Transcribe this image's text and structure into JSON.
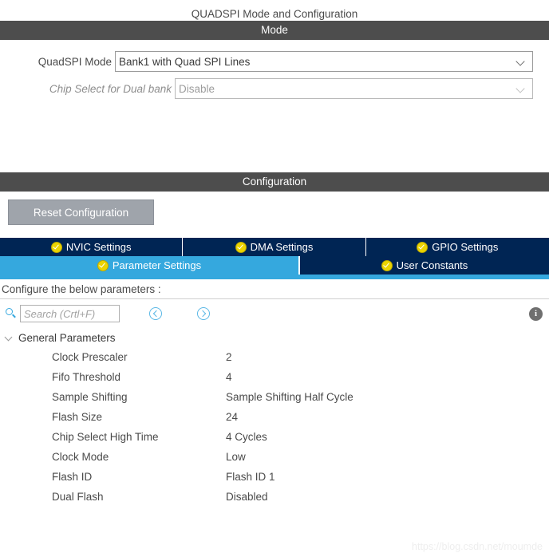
{
  "page_title": "QUADSPI Mode and Configuration",
  "mode_section": {
    "header": "Mode",
    "fields": [
      {
        "label": "QuadSPI Mode",
        "value": "Bank1 with Quad SPI Lines",
        "disabled": false
      },
      {
        "label": "Chip Select for Dual bank",
        "value": "Disable",
        "disabled": true
      }
    ]
  },
  "configuration_section": {
    "header": "Configuration",
    "reset_button": "Reset Configuration",
    "tabs_row1": [
      {
        "label": "NVIC Settings",
        "active": false,
        "icon": "check-circle-icon"
      },
      {
        "label": "DMA Settings",
        "active": false,
        "icon": "check-circle-icon"
      },
      {
        "label": "GPIO Settings",
        "active": false,
        "icon": "check-circle-icon"
      }
    ],
    "tabs_row2": [
      {
        "label": "Parameter Settings",
        "active": true,
        "icon": "check-circle-icon"
      },
      {
        "label": "User Constants",
        "active": false,
        "icon": "check-circle-icon"
      }
    ],
    "configure_text": "Configure the below parameters :",
    "toolbar": {
      "search_icon": "search-icon",
      "search_placeholder": "Search (Crtl+F)",
      "search_value": "",
      "prev_icon": "chevron-left-circle-icon",
      "next_icon": "chevron-right-circle-icon",
      "info_icon": "info-icon",
      "info_glyph": "i"
    },
    "parameter_tree": {
      "group_label": "General Parameters",
      "expanded": true,
      "rows": [
        {
          "name": "Clock Prescaler",
          "value": "2"
        },
        {
          "name": "Fifo Threshold",
          "value": "4"
        },
        {
          "name": "Sample Shifting",
          "value": "Sample Shifting Half Cycle"
        },
        {
          "name": "Flash Size",
          "value": "24"
        },
        {
          "name": "Chip Select High Time",
          "value": "4 Cycles"
        },
        {
          "name": "Clock Mode",
          "value": "Low"
        },
        {
          "name": "Flash ID",
          "value": "Flash ID 1"
        },
        {
          "name": "Dual Flash",
          "value": "Disabled"
        }
      ]
    }
  },
  "watermark": "https://blog.csdn.net/moumde",
  "colors": {
    "section_bar": "#4d4d4d",
    "tab_inactive": "#002554",
    "tab_active": "#35a8de",
    "check_badge": "#ecd400",
    "reset_button": "#9fa4ab",
    "accent_blue": "#35a8de"
  }
}
